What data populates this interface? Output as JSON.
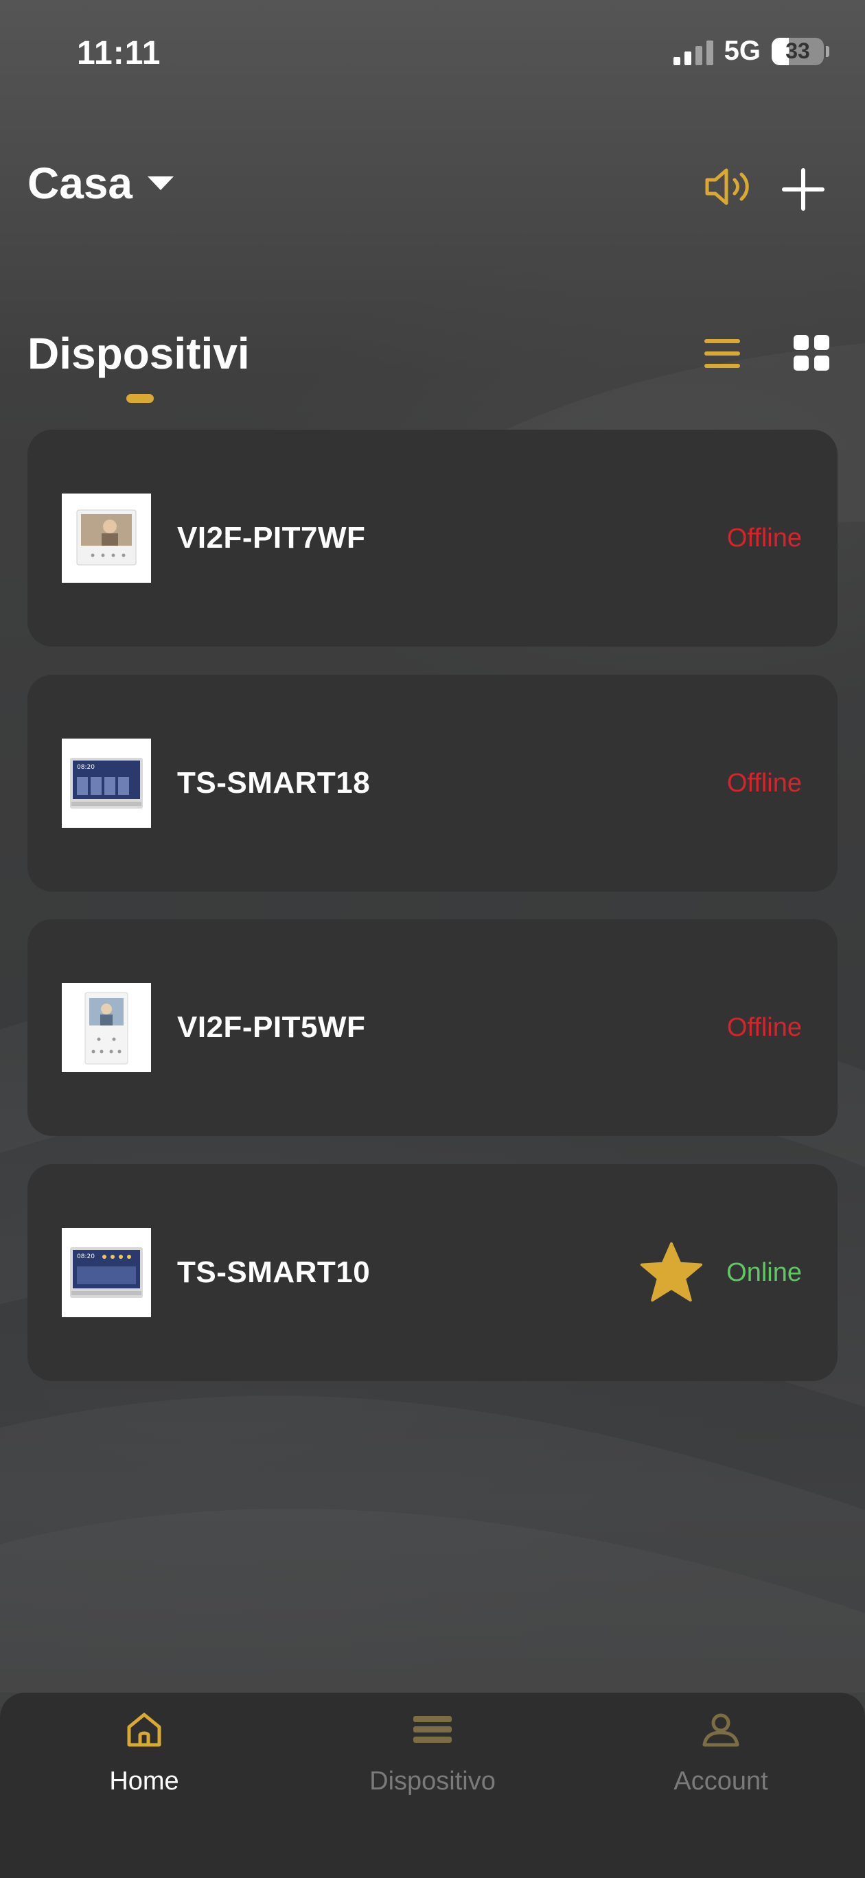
{
  "status_bar": {
    "time": "11:11",
    "network": "5G",
    "battery": "33",
    "battery_level": 0.33
  },
  "header": {
    "home_name": "Casa"
  },
  "section": {
    "title": "Dispositivi"
  },
  "devices": [
    {
      "name": "VI2F-PIT7WF",
      "status": "Offline",
      "favorite": false
    },
    {
      "name": "TS-SMART18",
      "status": "Offline",
      "favorite": false
    },
    {
      "name": "VI2F-PIT5WF",
      "status": "Offline",
      "favorite": false
    },
    {
      "name": "TS-SMART10",
      "status": "Online",
      "favorite": true
    }
  ],
  "tabs": [
    {
      "label": "Home",
      "icon": "home-icon",
      "active": true
    },
    {
      "label": "Dispositivo",
      "icon": "device-icon",
      "active": false
    },
    {
      "label": "Account",
      "icon": "account-icon",
      "active": false
    }
  ],
  "colors": {
    "accent": "#d9a933",
    "offline": "#d9232b",
    "online": "#5fc764",
    "card": "#333333",
    "tab_bar": "#2e2e2e"
  },
  "icons": {
    "speaker": "speaker-icon",
    "add": "plus-icon",
    "list_view": "list-view-icon",
    "grid_view": "grid-view-icon",
    "favorite": "star-icon"
  }
}
